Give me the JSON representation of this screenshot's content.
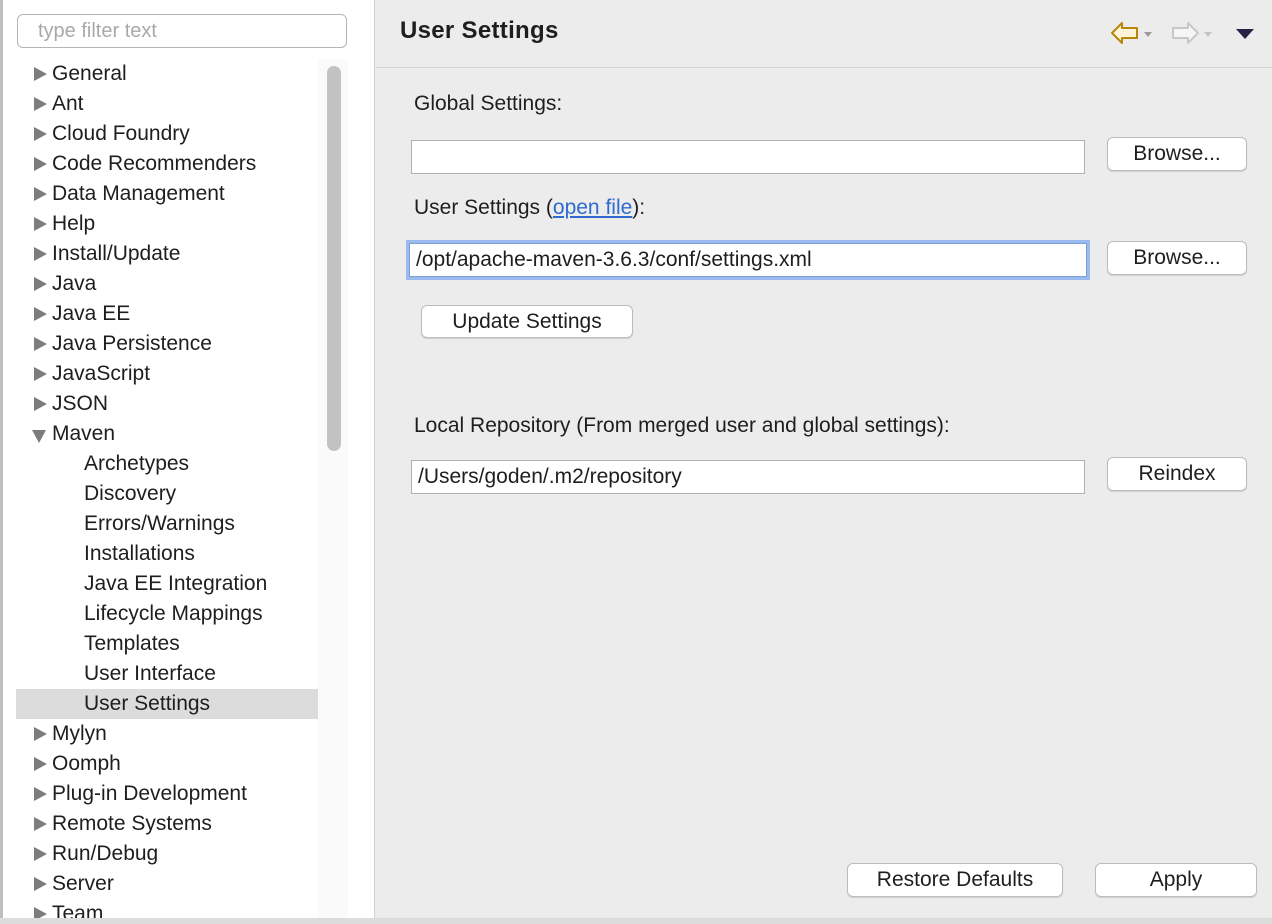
{
  "filter": {
    "placeholder": "type filter text"
  },
  "tree": [
    {
      "label": "General",
      "level": 0,
      "state": "collapsed"
    },
    {
      "label": "Ant",
      "level": 0,
      "state": "collapsed"
    },
    {
      "label": "Cloud Foundry",
      "level": 0,
      "state": "collapsed"
    },
    {
      "label": "Code Recommenders",
      "level": 0,
      "state": "collapsed"
    },
    {
      "label": "Data Management",
      "level": 0,
      "state": "collapsed"
    },
    {
      "label": "Help",
      "level": 0,
      "state": "collapsed"
    },
    {
      "label": "Install/Update",
      "level": 0,
      "state": "collapsed"
    },
    {
      "label": "Java",
      "level": 0,
      "state": "collapsed"
    },
    {
      "label": "Java EE",
      "level": 0,
      "state": "collapsed"
    },
    {
      "label": "Java Persistence",
      "level": 0,
      "state": "collapsed"
    },
    {
      "label": "JavaScript",
      "level": 0,
      "state": "collapsed"
    },
    {
      "label": "JSON",
      "level": 0,
      "state": "collapsed"
    },
    {
      "label": "Maven",
      "level": 0,
      "state": "expanded"
    },
    {
      "label": "Archetypes",
      "level": 1
    },
    {
      "label": "Discovery",
      "level": 1
    },
    {
      "label": "Errors/Warnings",
      "level": 1
    },
    {
      "label": "Installations",
      "level": 1
    },
    {
      "label": "Java EE Integration",
      "level": 1
    },
    {
      "label": "Lifecycle Mappings",
      "level": 1
    },
    {
      "label": "Templates",
      "level": 1
    },
    {
      "label": "User Interface",
      "level": 1
    },
    {
      "label": "User Settings",
      "level": 1,
      "selected": true
    },
    {
      "label": "Mylyn",
      "level": 0,
      "state": "collapsed"
    },
    {
      "label": "Oomph",
      "level": 0,
      "state": "collapsed"
    },
    {
      "label": "Plug-in Development",
      "level": 0,
      "state": "collapsed"
    },
    {
      "label": "Remote Systems",
      "level": 0,
      "state": "collapsed"
    },
    {
      "label": "Run/Debug",
      "level": 0,
      "state": "collapsed"
    },
    {
      "label": "Server",
      "level": 0,
      "state": "collapsed"
    },
    {
      "label": "Team",
      "level": 0,
      "state": "collapsed"
    }
  ],
  "page": {
    "title": "User Settings",
    "global_label": "Global Settings:",
    "global_value": "",
    "browse_label": "Browse...",
    "user_label_prefix": "User Settings (",
    "user_label_link": "open file",
    "user_label_suffix": "):",
    "user_value": "/opt/apache-maven-3.6.3/conf/settings.xml",
    "update_label": "Update Settings",
    "local_label": "Local Repository (From merged user and global settings):",
    "local_value": "/Users/goden/.m2/repository",
    "reindex_label": "Reindex",
    "restore_label": "Restore Defaults",
    "apply_label": "Apply"
  },
  "icons": {
    "back": "back-arrow-icon",
    "forward": "forward-arrow-icon",
    "menu": "view-menu-icon"
  },
  "colors": {
    "selection": "#dcdcdc",
    "focus_ring": "#9cbaf0",
    "link": "#2f6ad0",
    "back_arrow": "#b8860b"
  }
}
